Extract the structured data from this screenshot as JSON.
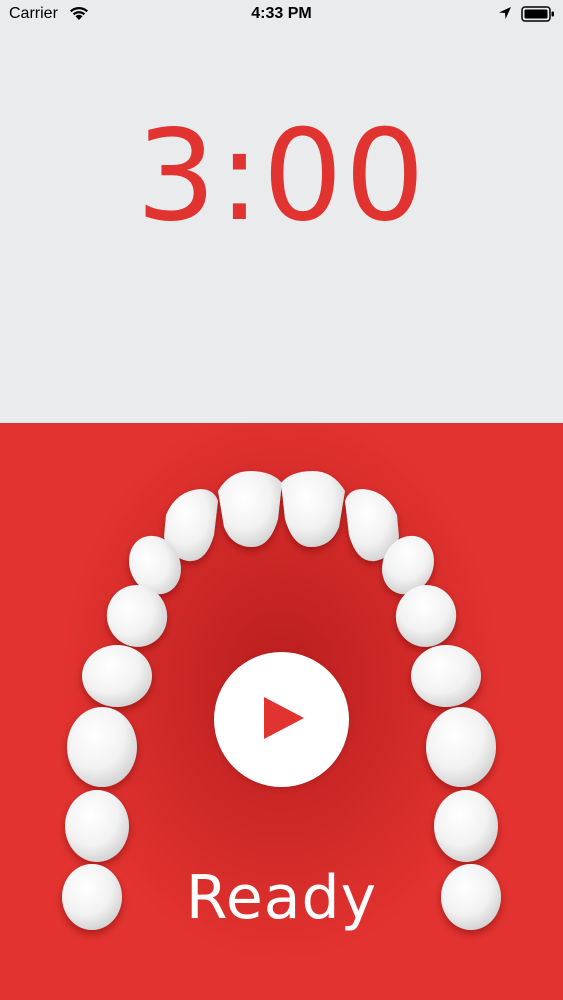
{
  "status_bar": {
    "carrier": "Carrier",
    "time": "4:33 PM"
  },
  "timer": {
    "display": "3:00"
  },
  "main": {
    "status_label": "Ready"
  },
  "icons": {
    "wifi": "wifi-icon",
    "location": "location-arrow-icon",
    "battery": "battery-icon",
    "play": "play-icon"
  },
  "colors": {
    "accent": "#e13431",
    "background_top": "#e9ebed",
    "background_bottom": "#e23330"
  }
}
